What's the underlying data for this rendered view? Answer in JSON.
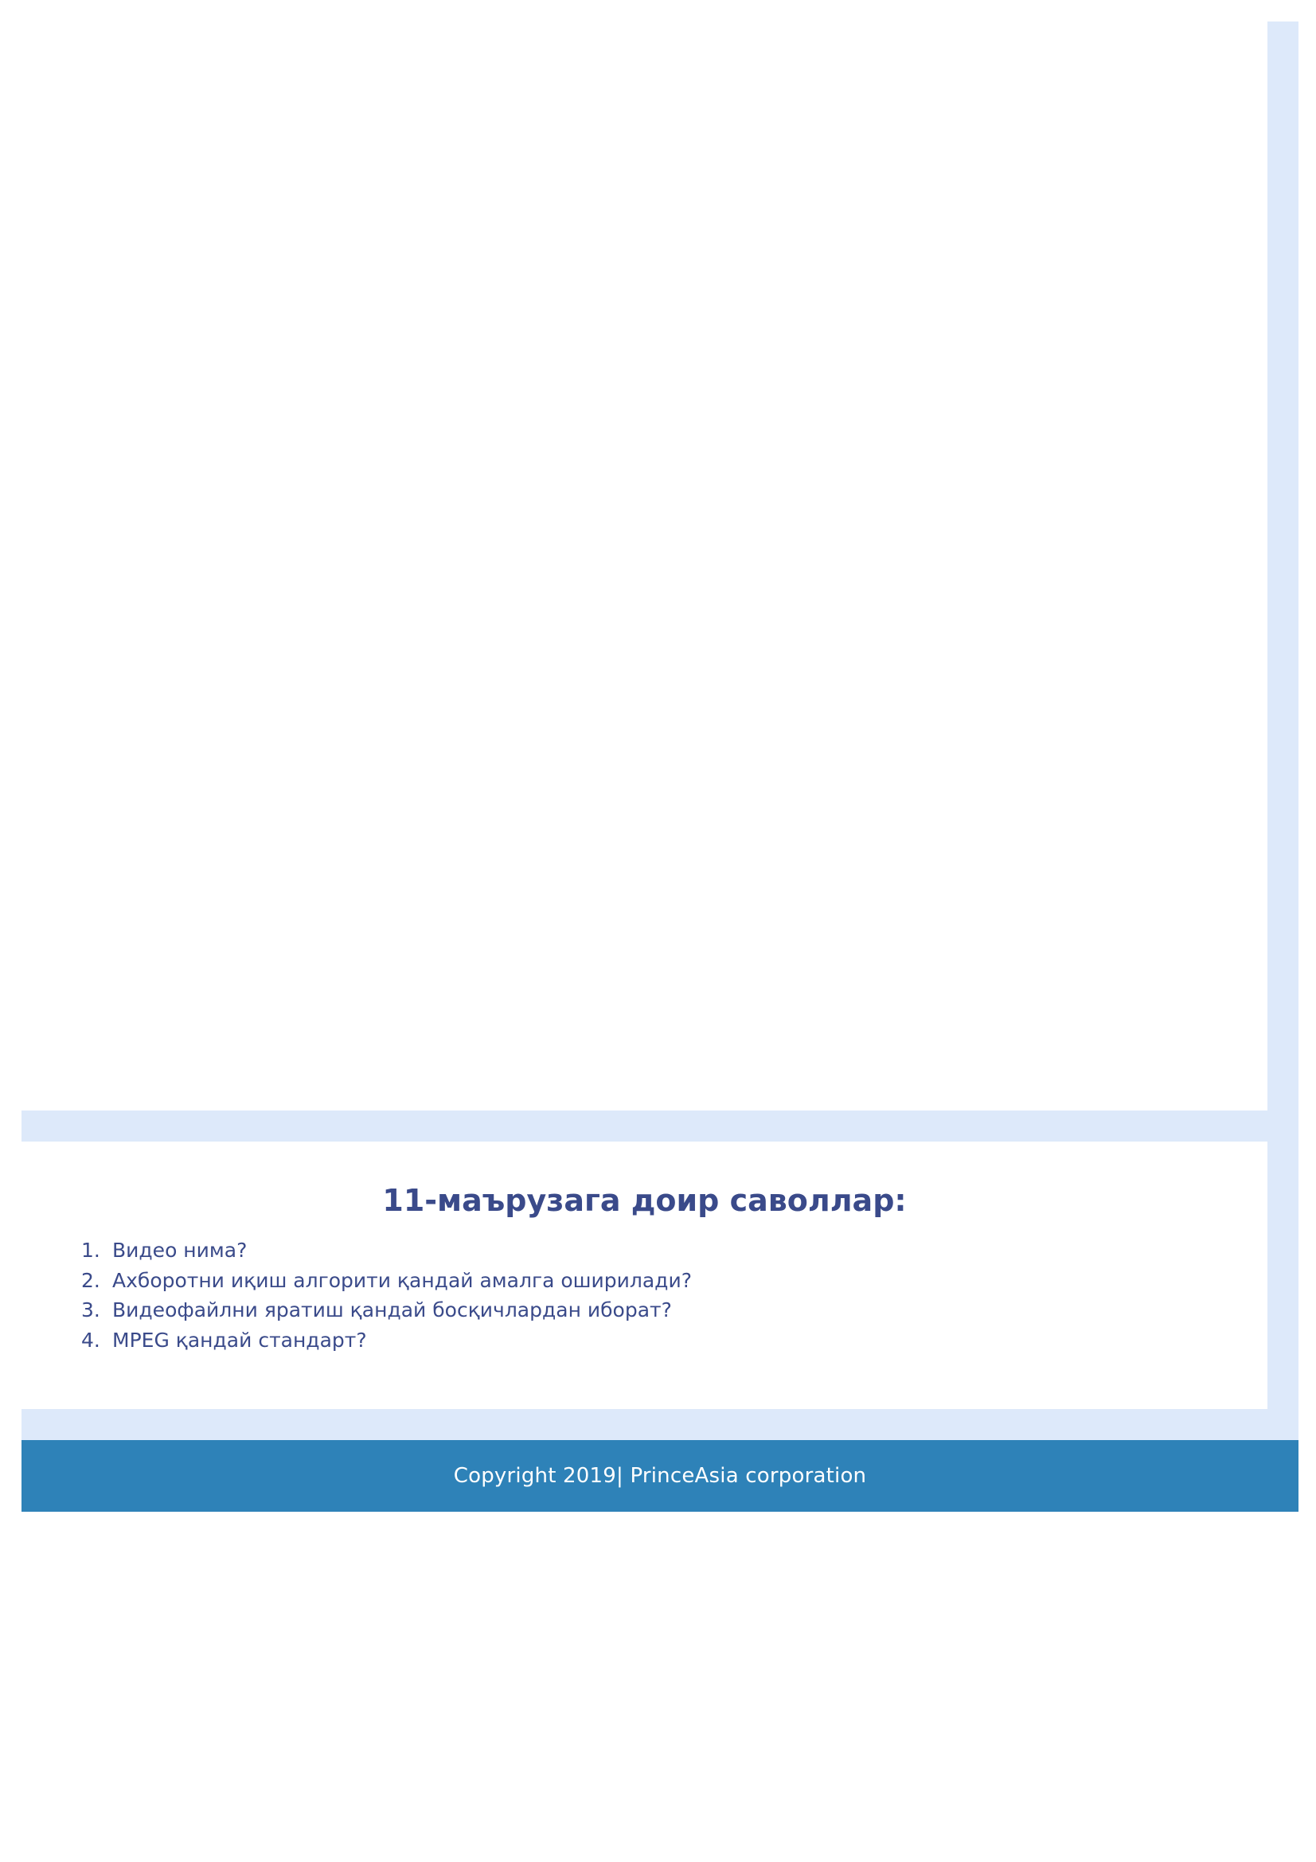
{
  "questions": {
    "title": "11-маърузага доир саволлар:",
    "items": [
      {
        "number": "1.",
        "text": "Видео нима?"
      },
      {
        "number": "2.",
        "text": "Ахборотни иқиш алгорити қандай амалга оширилади?"
      },
      {
        "number": "3.",
        "text": "Видеофайлни яратиш қандай босқичлардан иборат?"
      },
      {
        "number": "4.",
        "text": "MPEG қандай стандарт?"
      }
    ]
  },
  "footer": {
    "copyright": "Copyright 2019| PrinceAsia corporation"
  },
  "colors": {
    "frame": "#dde9fa",
    "footer_bg": "#2e82b8",
    "heading_text": "#3a4a8a"
  }
}
